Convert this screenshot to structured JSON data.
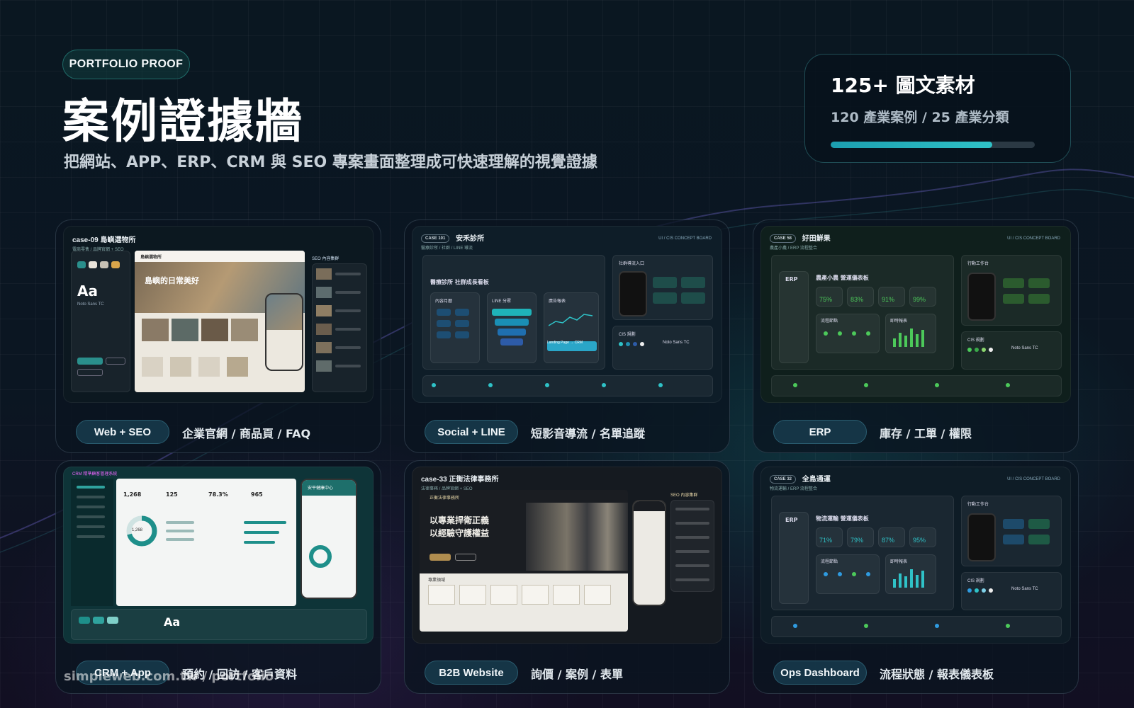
{
  "header": {
    "badge": "PORTFOLIO PROOF",
    "title": "案例證據牆",
    "subtitle": "把網站、APP、ERP、CRM 與 SEO 專案畫面整理成可快速理解的視覺證據"
  },
  "stats": {
    "main": "125+ 圖文素材",
    "sub": "120 產業案例 / 25 產業分類",
    "progress": 0.79
  },
  "cards": [
    {
      "tag": "Web + SEO",
      "desc": "企業官網 / 商品頁 / FAQ",
      "shot": {
        "case": "case-09",
        "name": "島嶼選物所",
        "meta": "電商零售 / 品牌官網 + SEO",
        "hero": "島嶼的日常美好",
        "brand": "島嶼選物所",
        "side_title": "SEO 內容集群",
        "aa": "Aa",
        "font": "Noto Sans TC"
      }
    },
    {
      "tag": "Social + LINE",
      "desc": "短影音導流 / 名單追蹤",
      "shot": {
        "case": "CASE 101",
        "name": "安禾診所",
        "meta": "醫療診所 / 社群 / LINE 導流",
        "board": "UI / CIS CONCEPT BOARD",
        "panel_title": "醫療診所 社群成長看板",
        "col1": "內容月曆",
        "col2": "LINE 分眾",
        "col3": "廣告報表",
        "side1": "社群導流入口",
        "side2": "CIS 規劃",
        "font": "Noto Sans TC",
        "landing": "Landing Page → CRM"
      }
    },
    {
      "tag": "ERP",
      "desc": "庫存 / 工單 / 權限",
      "shot": {
        "case": "CASE 58",
        "name": "好田鮮果",
        "meta": "農產小農 / ERP 流程整合",
        "board": "UI / CIS CONCEPT BOARD",
        "panel_title": "農產小農 營運儀表板",
        "erp": "ERP",
        "kpis": [
          "75%",
          "83%",
          "91%",
          "99%"
        ],
        "flow": "流程節點",
        "report": "即時報表",
        "side1": "行動工作台",
        "side2": "CIS 規劃",
        "font": "Noto Sans TC"
      }
    },
    {
      "tag": "CRM + App",
      "desc": "預約 / 回訪 / 客戶資料",
      "shot": {
        "name": "CRM 精準顧客管理系統",
        "kpis": [
          "1,268",
          "125",
          "78.3%",
          "965"
        ],
        "donut": "1,268",
        "app_title": "安平健康中心",
        "aa": "Aa",
        "font": "Noto Sans TC"
      }
    },
    {
      "tag": "B2B Website",
      "desc": "詢價 / 案例 / 表單",
      "shot": {
        "case": "case-33",
        "name": "正衡法律事務所",
        "meta": "法律事務 / 品牌官網 + SEO",
        "hero1": "以專業捍衛正義",
        "hero2": "以經驗守護權益",
        "brand": "正衡法律事務所",
        "side_title": "SEO 內容集群",
        "section": "專業領域"
      }
    },
    {
      "tag": "Ops Dashboard",
      "desc": "流程狀態 / 報表儀表板",
      "shot": {
        "case": "CASE 32",
        "name": "全島通運",
        "meta": "物流運輸 / ERP 流程整合",
        "board": "UI / CIS CONCEPT BOARD",
        "panel_title": "物流運輸 營運儀表板",
        "erp": "ERP",
        "kpis": [
          "71%",
          "79%",
          "87%",
          "95%"
        ],
        "flow": "流程節點",
        "report": "即時報表",
        "side1": "行動工作台",
        "side2": "CIS 規劃",
        "font": "Noto Sans TC"
      }
    }
  ],
  "watermark": "simpleweb.com.tw / portfolio",
  "colors": {
    "accent_teal": "#2fc2c7",
    "accent_green": "#4cc95a",
    "card_bg": "#0a1420"
  }
}
